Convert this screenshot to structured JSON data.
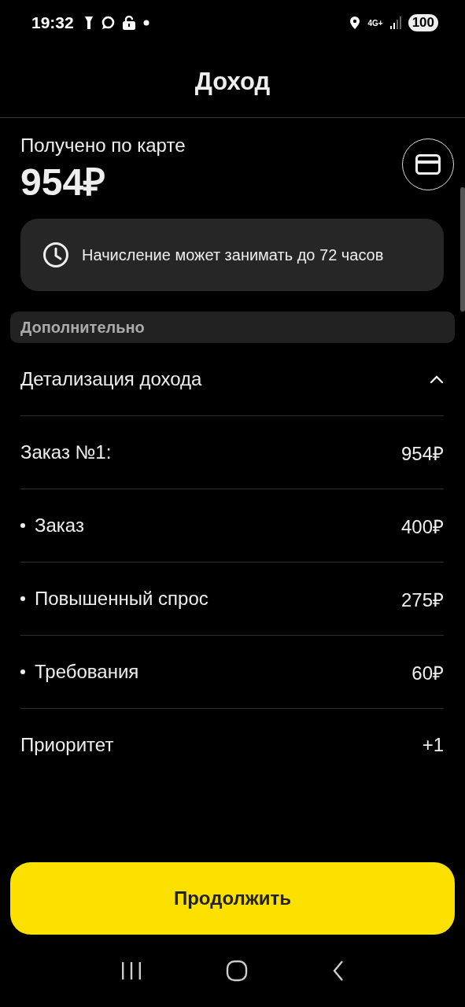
{
  "status_bar": {
    "time": "19:32",
    "network": "4G+",
    "battery": "100"
  },
  "header": {
    "title": "Доход"
  },
  "received": {
    "label": "Получено по карте",
    "amount": "954₽"
  },
  "notice": {
    "text": "Начисление может занимать до 72 часов"
  },
  "section": {
    "title": "Дополнительно"
  },
  "details": {
    "title": "Детализация дохода",
    "expanded": true,
    "rows": [
      {
        "kind": "plain",
        "label": "Заказ №1:",
        "value": "954₽"
      },
      {
        "kind": "bullet",
        "label": "Заказ",
        "value": "400₽"
      },
      {
        "kind": "bullet",
        "label": "Повышенный спрос",
        "value": "275₽"
      },
      {
        "kind": "bullet",
        "label": "Требования",
        "value": "60₽"
      },
      {
        "kind": "plain",
        "label": "Приоритет",
        "value": "+1"
      }
    ]
  },
  "continue_button": {
    "label": "Продолжить"
  }
}
